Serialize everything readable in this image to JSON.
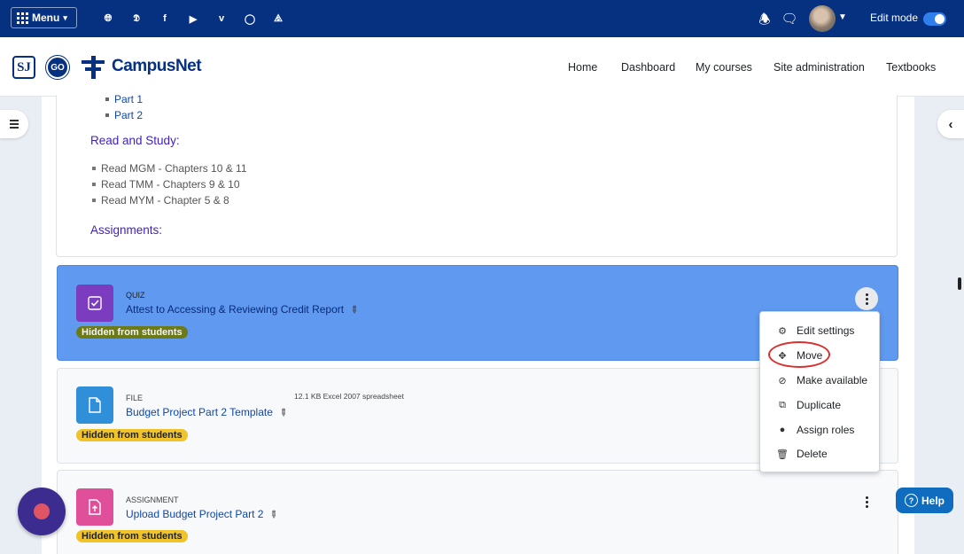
{
  "topbar": {
    "menu_label": "Menu",
    "social_icons": [
      "globe-icon",
      "twitter-icon",
      "facebook-icon",
      "youtube-icon",
      "vimeo-icon",
      "instagram-icon",
      "rss-icon"
    ],
    "edit_mode_label": "Edit mode",
    "edit_mode_on": true
  },
  "navbar": {
    "logo_sj": "SJ",
    "logo_go": "GO",
    "site_name": "CampusNet",
    "links": [
      "Home",
      "Dashboard",
      "My courses",
      "Site administration",
      "Textbooks"
    ]
  },
  "summary": {
    "parts": [
      "Part 1",
      "Part 2"
    ],
    "read_heading": "Read and Study:",
    "read_items": [
      "Read MGM - Chapters 10 & 11",
      "Read TMM - Chapters 9 & 10",
      "Read MYM - Chapter 5 & 8"
    ],
    "assign_heading": "Assignments:"
  },
  "activities": [
    {
      "type": "QUIZ",
      "name": "Attest to Accessing & Reviewing Credit Report",
      "badge": "Hidden from students",
      "color": "#7c3cbf"
    },
    {
      "type": "FILE",
      "name": "Budget Project Part 2 Template",
      "badge": "Hidden from students",
      "meta": "12.1 KB Excel 2007 spreadsheet",
      "color": "#2f8fd8"
    },
    {
      "type": "ASSIGNMENT",
      "name": "Upload Budget Project Part 2",
      "badge": "Hidden from students",
      "color": "#e0509a"
    }
  ],
  "menu": {
    "items": [
      "Edit settings",
      "Move",
      "Make available",
      "Duplicate",
      "Assign roles",
      "Delete"
    ]
  },
  "help_label": "Help",
  "colors": {
    "topbar": "#063080",
    "selected": "#5f99f0",
    "badge": "#f0c428",
    "link": "#0f47ad"
  }
}
